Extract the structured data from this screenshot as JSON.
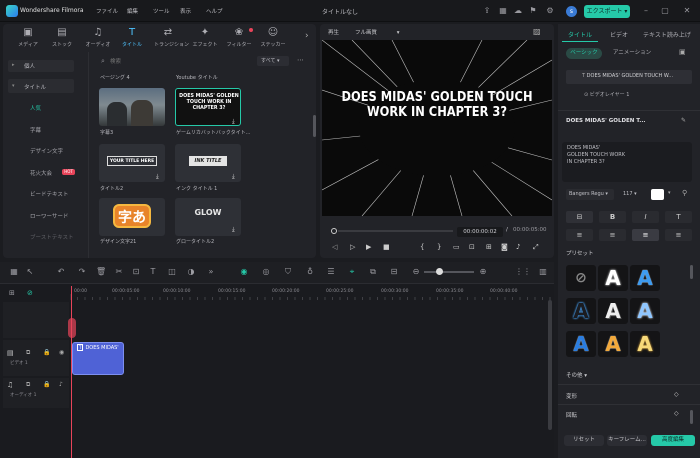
{
  "app": {
    "name": "Wondershare Filmora",
    "project_title": "タイトルなし",
    "export_label": "エクスポート",
    "avatar_letter": "s"
  },
  "menu": [
    "ファイル",
    "編集",
    "ツール",
    "表示",
    "ヘルプ"
  ],
  "media_tabs": [
    {
      "label": "メディア",
      "icon": "media-icon"
    },
    {
      "label": "ストック",
      "icon": "stock-icon"
    },
    {
      "label": "オーディオ",
      "icon": "audio-icon"
    },
    {
      "label": "タイトル",
      "icon": "title-icon",
      "active": true
    },
    {
      "label": "トランジション",
      "icon": "transition-icon"
    },
    {
      "label": "エフェクト",
      "icon": "effect-icon"
    },
    {
      "label": "フィルター",
      "icon": "filter-icon"
    },
    {
      "label": "ステッカー",
      "icon": "sticker-icon"
    }
  ],
  "sidebar": {
    "items": [
      {
        "label": "個人"
      },
      {
        "label": "タイトル"
      }
    ],
    "sub_items": [
      {
        "label": "人気",
        "active": true
      },
      {
        "label": "字幕"
      },
      {
        "label": "デザイン文字"
      },
      {
        "label": "花火大会",
        "badge": "HOT"
      },
      {
        "label": "ビードテキスト"
      },
      {
        "label": "ローワーサード"
      },
      {
        "label": "ブーストテキスト"
      }
    ]
  },
  "search": {
    "placeholder": "検索",
    "filter": "すべて"
  },
  "thumbnails": [
    {
      "label": "ページング 4",
      "text": ""
    },
    {
      "label": "Youtube タイトル",
      "text": ""
    },
    {
      "label": "字幕3",
      "text": ""
    },
    {
      "label": "ゲームリカバットバックタイト...",
      "text": "DOES MIDAS' GOLDEN TOUCH WORK IN CHAPTER 3?"
    },
    {
      "label": "タイトル2",
      "text": "YOUR TITLE HERE"
    },
    {
      "label": "インク タイトル 1",
      "text": "INK TITLE"
    },
    {
      "label": "デザイン文字21",
      "text": "字あ"
    },
    {
      "label": "グロータイトル2",
      "text": "GLOW"
    }
  ],
  "preview": {
    "player_label": "再生",
    "quality": "フル画質",
    "canvas_text": "DOES MIDAS' GOLDEN TOUCH WORK IN CHAPTER 3?",
    "current_time": "00:00:00:02",
    "total_time": "00:00:05:00",
    "separator": "/"
  },
  "right_panel": {
    "tabs": [
      {
        "label": "タイトル",
        "active": true
      },
      {
        "label": "ビデオ"
      },
      {
        "label": "テキスト読み上げ"
      }
    ],
    "subtabs": [
      {
        "label": "ベーシック",
        "active": true
      },
      {
        "label": "アニメーション"
      }
    ],
    "layer_title": "DOES MIDAS' GOLDEN TOUCH W...",
    "layer_video": "ビデオレイヤー 1",
    "section_title": "DOES MIDAS' GOLDEN T...",
    "text_content": "DOES MIDAS'\nGOLDEN TOUCH WORK\nIN CHAPTER 3?",
    "font": "Bangers Regu",
    "size": "117",
    "presets_label": "プリセット",
    "other_label": "その他",
    "transform_label": "変形",
    "rotate_label": "回転",
    "reset_label": "リセット",
    "keyframe_label": "キーフレーム...",
    "advanced_label": "高度編集"
  },
  "timeline": {
    "ruler": [
      "00:00",
      "00:00:05:00",
      "00:00:10:00",
      "00:00:15:00",
      "00:00:20:00",
      "00:00:25:00",
      "00:00:30:00",
      "00:00:35:00",
      "00:00:40:00"
    ],
    "video_track_label": "ビデオ 1",
    "audio_track_label": "オーディオ 1",
    "clip_label": "DOES MIDAS'"
  },
  "colors": {
    "accent": "#25c9a8",
    "playhead": "#e8445a",
    "clip": "#4f62d6"
  }
}
